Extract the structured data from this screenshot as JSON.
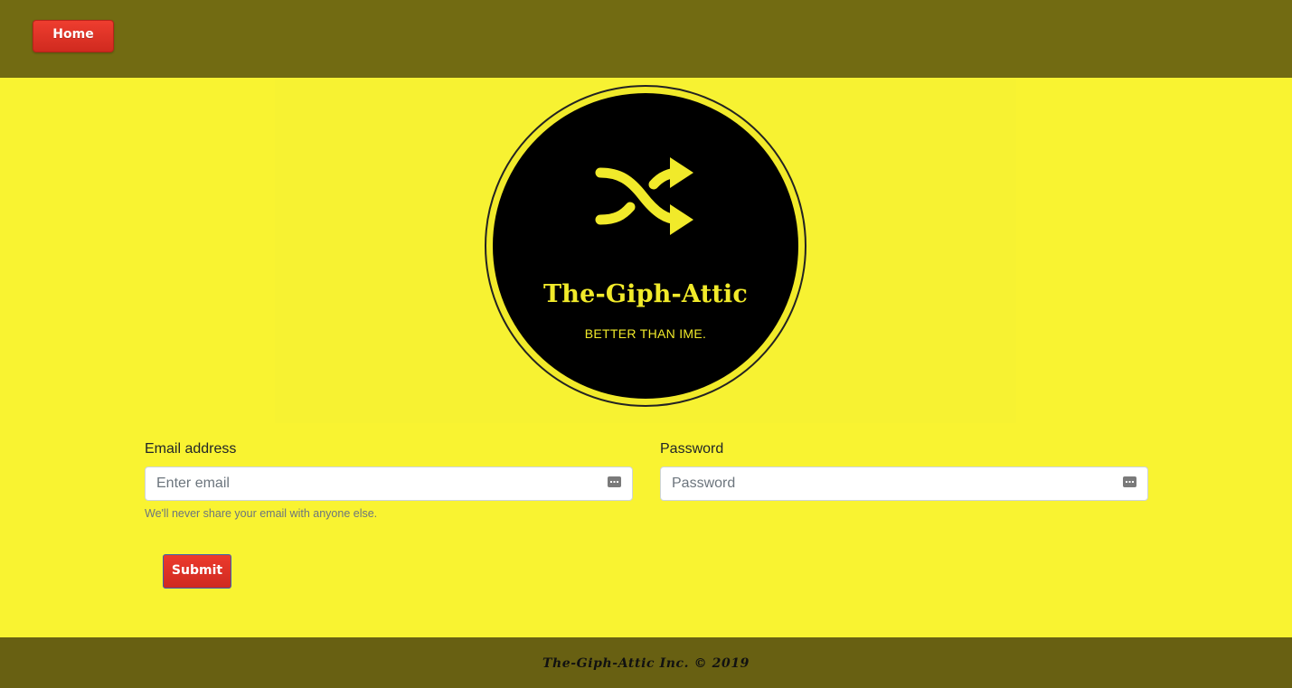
{
  "nav": {
    "home_label": "Home"
  },
  "logo": {
    "title": "The-Giph-Attic",
    "tagline": "BETTER THAN IME.",
    "icon": "shuffle-icon",
    "background_color": "#000000",
    "accent_color": "#f1ea2a"
  },
  "form": {
    "email": {
      "label": "Email address",
      "placeholder": "Enter email",
      "value": "",
      "help": "We'll never share your email with anyone else."
    },
    "password": {
      "label": "Password",
      "placeholder": "Password",
      "value": ""
    },
    "submit_label": "Submit"
  },
  "footer": {
    "text": "The-Giph-Attic Inc. © 2019"
  },
  "colors": {
    "page_background": "#f9f331",
    "header_background": "#726b12",
    "footer_background": "#686012",
    "button_red": "#e0342a"
  }
}
